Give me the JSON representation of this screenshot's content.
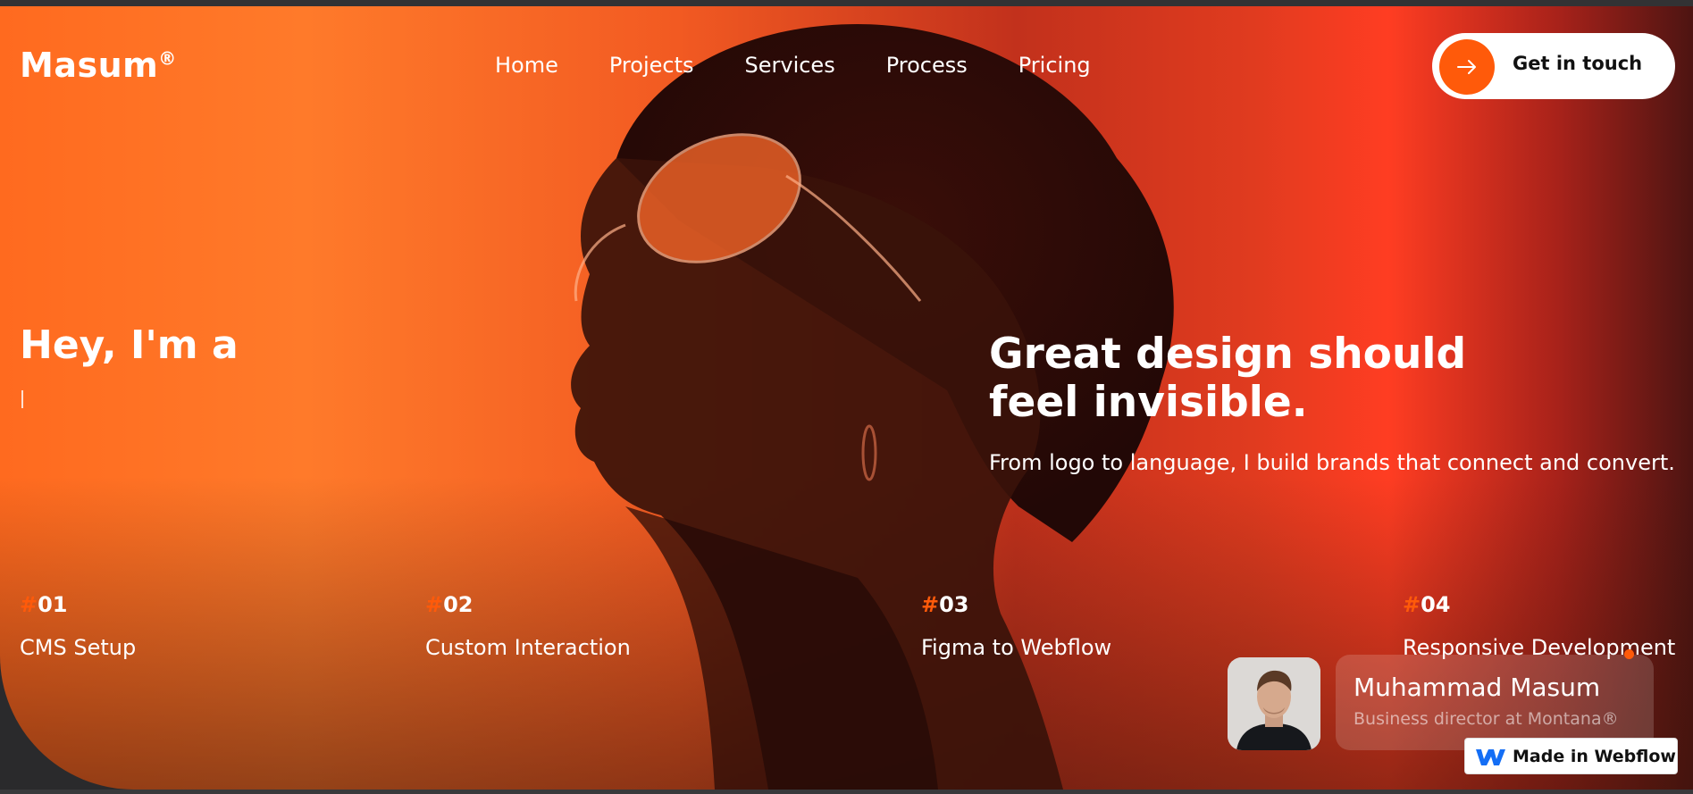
{
  "brand": {
    "name": "Masum",
    "mark": "®"
  },
  "nav": {
    "items": [
      "Home",
      "Projects",
      "Services",
      "Process",
      "Pricing"
    ]
  },
  "cta": {
    "label": "Get in touch",
    "icon": "arrow-right-icon"
  },
  "hero": {
    "intro": "Hey, I'm a",
    "headline": "Great design should feel invisible.",
    "subline": "From logo to language, I build brands that connect and convert."
  },
  "features": [
    {
      "hash": "#",
      "num": "01",
      "title": "CMS Setup"
    },
    {
      "hash": "#",
      "num": "02",
      "title": "Custom Interaction"
    },
    {
      "hash": "#",
      "num": "03",
      "title": "Figma to Webflow"
    },
    {
      "hash": "#",
      "num": "04",
      "title": "Responsive Development"
    }
  ],
  "profile": {
    "name": "Muhammad Masum",
    "role": "Business director at Montana®"
  },
  "badge": {
    "label": "Made in Webflow",
    "icon": "webflow-icon"
  },
  "colors": {
    "accent": "#ff5a0a",
    "text": "#ffffff"
  }
}
